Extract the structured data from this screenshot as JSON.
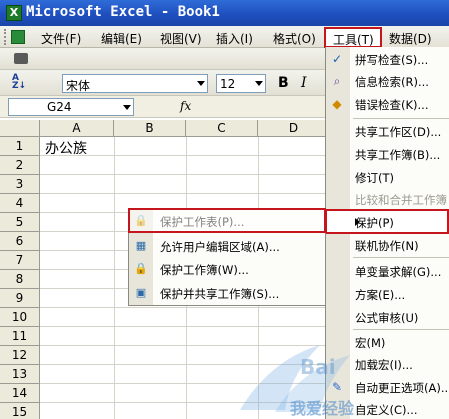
{
  "window": {
    "title": "Microsoft Excel - Book1",
    "app_icon": "excel-icon"
  },
  "menubar": {
    "items": [
      "文件(F)",
      "编辑(E)",
      "视图(V)",
      "插入(I)",
      "格式(O)",
      "工具(T)",
      "数据(D)"
    ]
  },
  "toolbar": {
    "font_name": "宋体",
    "font_size": "12",
    "bold_label": "B",
    "italic_label": "I"
  },
  "formula_bar": {
    "name_box": "G24",
    "fx_label": "fx"
  },
  "sheet": {
    "columns": [
      "A",
      "B",
      "C",
      "D"
    ],
    "rows": [
      "1",
      "2",
      "3",
      "4",
      "5",
      "6",
      "7",
      "8",
      "9",
      "10",
      "11",
      "12",
      "13",
      "14",
      "15"
    ],
    "cells": {
      "A1": "办公族"
    }
  },
  "tools_menu": {
    "items": [
      {
        "label": "拼写检查(S)...",
        "icon": "spellcheck-icon"
      },
      {
        "label": "信息检索(R)...",
        "icon": "research-icon"
      },
      {
        "label": "错误检查(K)...",
        "icon": "error-check-icon"
      },
      {
        "label": "共享工作区(D)...",
        "icon": ""
      },
      {
        "label": "共享工作簿(B)...",
        "icon": ""
      },
      {
        "label": "修订(T)",
        "icon": ""
      },
      {
        "label": "比较和合并工作簿",
        "icon": "",
        "disabled": true
      },
      {
        "label": "保护(P)",
        "icon": "",
        "highlighted": true,
        "has_submenu": true
      },
      {
        "label": "联机协作(N)",
        "icon": ""
      },
      {
        "label": "单变量求解(G)...",
        "icon": ""
      },
      {
        "label": "方案(E)...",
        "icon": ""
      },
      {
        "label": "公式审核(U)",
        "icon": ""
      },
      {
        "label": "宏(M)",
        "icon": ""
      },
      {
        "label": "加载宏(I)...",
        "icon": ""
      },
      {
        "label": "自动更正选项(A)...",
        "icon": "autocorrect-icon"
      },
      {
        "label": "自定义(C)...",
        "icon": ""
      }
    ]
  },
  "protect_submenu": {
    "items": [
      {
        "label": "保护工作表(P)...",
        "icon": "protect-sheet-icon",
        "highlighted": true
      },
      {
        "label": "允许用户编辑区域(A)...",
        "icon": "allow-edit-ranges-icon"
      },
      {
        "label": "保护工作簿(W)...",
        "icon": "protect-workbook-icon"
      },
      {
        "label": "保护并共享工作簿(S)...",
        "icon": "protect-share-icon"
      }
    ]
  },
  "watermark": {
    "text": "我爱经验",
    "brand": "Bai"
  },
  "colors": {
    "highlight_border": "#c4161c",
    "title_bar": "#1f4fbf",
    "menu_gutter": "#e8e6da"
  }
}
